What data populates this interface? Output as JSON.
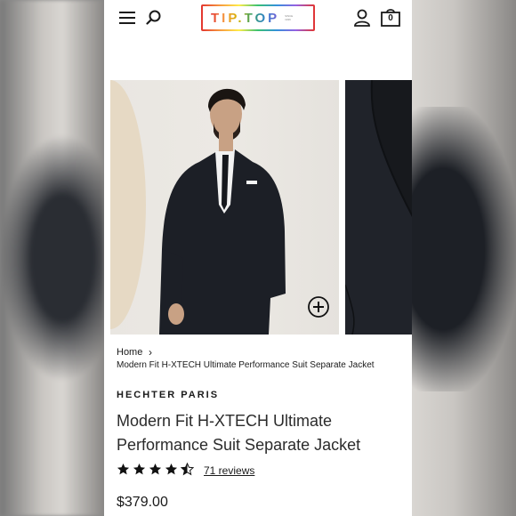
{
  "header": {
    "logo_text": "TIP.TOP",
    "logo_subtext": "SINCE 1936",
    "cart_count": "0"
  },
  "breadcrumb": {
    "home": "Home",
    "current": "Modern Fit H-XTECH Ultimate Performance Suit Separate Jacket"
  },
  "product": {
    "brand": "HECHTER PARIS",
    "title": "Modern Fit H-XTECH Ultimate Performance Suit Separate Jacket",
    "rating": 4.5,
    "reviews": "71 reviews",
    "price": "$379.00"
  },
  "colors": {
    "text": "#1a1a1a",
    "suit": "#1c1f26"
  },
  "icons": [
    "hamburger-menu-icon",
    "search-icon",
    "account-icon",
    "cart-icon",
    "zoom-in-icon",
    "star-icon",
    "chevron-right-icon"
  ]
}
